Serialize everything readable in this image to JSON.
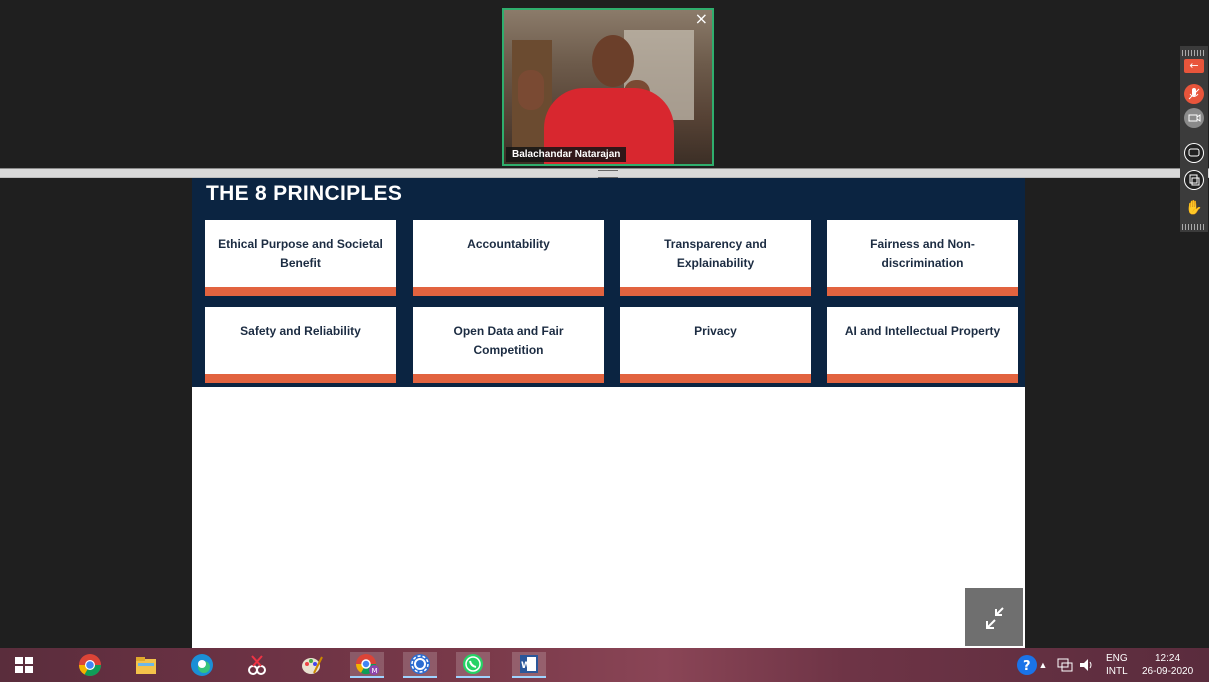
{
  "video": {
    "participant_name": "Balachandar Natarajan",
    "close_glyph": "×"
  },
  "slide": {
    "title": "THE 8 PRINCIPLES",
    "cards": [
      {
        "label": "Ethical Purpose and Societal Benefit"
      },
      {
        "label": "Accountability"
      },
      {
        "label": "Transparency and Explainability"
      },
      {
        "label": "Fairness and Non-discrimination"
      },
      {
        "label": "Safety and Reliability"
      },
      {
        "label": "Open Data and Fair Competition"
      },
      {
        "label": "Privacy"
      },
      {
        "label": "AI and Intellectual Property"
      }
    ],
    "colors": {
      "header": "#0b2441",
      "accent": "#e2633f"
    }
  },
  "toolbar": {
    "icons": [
      "back-arrow-icon",
      "microphone-icon",
      "camera-icon",
      "chat-icon",
      "copy-icon",
      "raise-hand-icon"
    ]
  },
  "taskbar": {
    "apps": [
      "start-icon",
      "chrome-icon",
      "file-explorer-icon",
      "edge-icon",
      "snipping-tool-icon",
      "paint-icon",
      "chrome-profile-icon",
      "settings-icon",
      "whatsapp-icon",
      "word-icon"
    ],
    "language": "ENG",
    "keyboard": "INTL",
    "time": "12:24",
    "date": "26-09-2020"
  }
}
